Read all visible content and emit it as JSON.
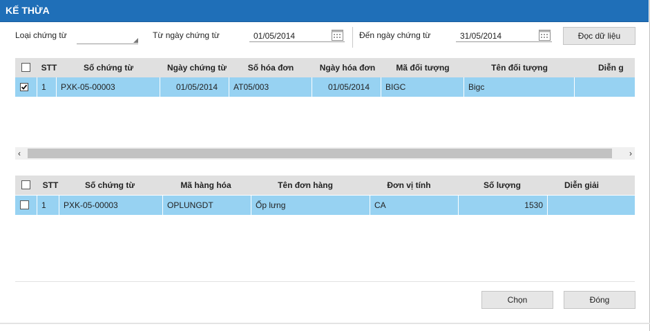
{
  "window": {
    "title": "KẾ THỪA"
  },
  "filters": {
    "doc_type_label": "Loại chứng từ",
    "doc_type_value": "",
    "from_date_label": "Từ ngày chứng từ",
    "from_date_value": "01/05/2014",
    "to_date_label": "Đến ngày chứng từ",
    "to_date_value": "31/05/2014",
    "load_button": "Đọc dữ liệu"
  },
  "table1": {
    "columns": [
      "STT",
      "Số chứng từ",
      "Ngày chứng từ",
      "Số hóa đơn",
      "Ngày hóa đơn",
      "Mã đối tượng",
      "Tên đối tượng",
      "Diễn g"
    ],
    "rows": [
      {
        "checked": true,
        "stt": "1",
        "so_chung_tu": "PXK-05-00003",
        "ngay_chung_tu": "01/05/2014",
        "so_hoa_don": "AT05/003",
        "ngay_hoa_don": "01/05/2014",
        "ma_doi_tuong": "BIGC",
        "ten_doi_tuong": "Bigc",
        "dien_giai": ""
      }
    ]
  },
  "table2": {
    "columns": [
      "STT",
      "Số chứng từ",
      "Mã hàng hóa",
      "Tên đơn hàng",
      "Đơn vị tính",
      "Số lượng",
      "Diễn giải"
    ],
    "rows": [
      {
        "checked": false,
        "stt": "1",
        "so_chung_tu": "PXK-05-00003",
        "ma_hang_hoa": "OPLUNGDT",
        "ten_don_hang": "Ốp lưng",
        "don_vi_tinh": "CA",
        "so_luong": "1530",
        "dien_giai": ""
      }
    ]
  },
  "footer": {
    "select_button": "Chọn",
    "close_button": "Đóng"
  },
  "colors": {
    "title_bar": "#1f6fb8",
    "selected_row": "#97d2f2",
    "header_bg": "#e0e0e0"
  },
  "icons": {
    "calendar": "calendar-icon",
    "dropdown": "dropdown-arrow-icon"
  }
}
